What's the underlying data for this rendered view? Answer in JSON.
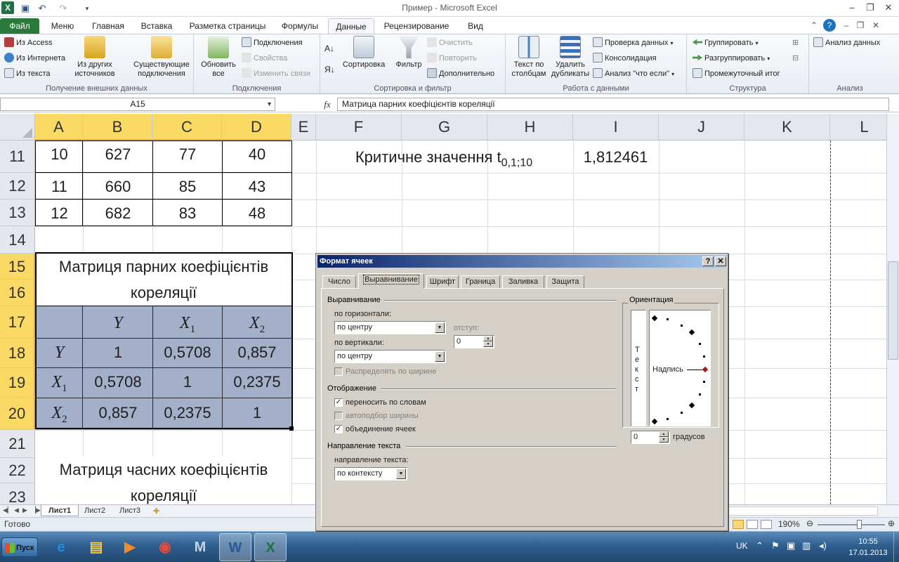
{
  "window": {
    "title": "Пример - Microsoft Excel",
    "app_icon": "X",
    "qat": {
      "save": "save-icon",
      "undo": "undo-icon",
      "redo": "redo-icon",
      "customize": "dropdown-icon"
    },
    "buttons": {
      "minimize": "–",
      "restore": "❐",
      "close": "✕"
    }
  },
  "ribbon_tabs": [
    {
      "label": "Файл"
    },
    {
      "label": "Меню"
    },
    {
      "label": "Главная"
    },
    {
      "label": "Вставка"
    },
    {
      "label": "Разметка страницы"
    },
    {
      "label": "Формулы"
    },
    {
      "label": "Данные"
    },
    {
      "label": "Рецензирование"
    },
    {
      "label": "Вид"
    }
  ],
  "ribbon": {
    "external": {
      "label": "Получение внешних данных",
      "access": "Из Access",
      "web": "Из Интернета",
      "text": "Из текста",
      "other_1": "Из других",
      "other_2": "источников",
      "existing_1": "Существующие",
      "existing_2": "подключения"
    },
    "connections": {
      "label": "Подключения",
      "refresh_1": "Обновить",
      "refresh_2": "все",
      "connections": "Подключения",
      "properties": "Свойства",
      "edit_links": "Изменить связи"
    },
    "sort": {
      "label": "Сортировка и фильтр",
      "sort": "Сортировка",
      "filter": "Фильтр",
      "clear": "Очистить",
      "reapply": "Повторить",
      "advanced": "Дополнительно"
    },
    "datatools": {
      "label": "Работа с данными",
      "t2c_1": "Текст по",
      "t2c_2": "столбцам",
      "dup_1": "Удалить",
      "dup_2": "дубликаты",
      "validation": "Проверка данных",
      "consolidate": "Консолидация",
      "whatif": "Анализ \"что если\""
    },
    "outline": {
      "label": "Структура",
      "group": "Группировать",
      "ungroup": "Разгруппировать",
      "subtotal": "Промежуточный итог"
    },
    "analysis": {
      "label": "Анализ",
      "data_analysis": "Анализ данных"
    }
  },
  "formula_bar": {
    "name_box": "A15",
    "fx": "fx",
    "formula": "Матрица парних коефіцієнтів кореляції"
  },
  "columns": [
    "A",
    "B",
    "C",
    "D",
    "E",
    "F",
    "G",
    "H",
    "I",
    "J",
    "K",
    "L"
  ],
  "rows": [
    "11",
    "12",
    "13",
    "14",
    "15",
    "16",
    "17",
    "18",
    "19",
    "20",
    "21",
    "22",
    "23"
  ],
  "sheet": {
    "data_rows": [
      [
        "10",
        "627",
        "77",
        "40"
      ],
      [
        "11",
        "660",
        "85",
        "43"
      ],
      [
        "12",
        "682",
        "83",
        "48"
      ]
    ],
    "critical_label": "Критичне значення t",
    "critical_sub": "0,1;10",
    "critical_value": "1,812461",
    "title1_line1": "Матриця парних коефіцієнтів",
    "title1_line2": "кореляції",
    "matrix_header": [
      "",
      "Y",
      "X",
      "X"
    ],
    "matrix_header_sub": [
      "",
      "",
      "1",
      "2"
    ],
    "matrix_rows": [
      {
        "label": "Y",
        "sub": "",
        "values": [
          "1",
          "0,5708",
          "0,857"
        ]
      },
      {
        "label": "X",
        "sub": "1",
        "values": [
          "0,5708",
          "1",
          "0,2375"
        ]
      },
      {
        "label": "X",
        "sub": "2",
        "values": [
          "0,857",
          "0,2375",
          "1"
        ]
      }
    ],
    "title2_line1": "Матриця часних коефіцієнтів",
    "title2_line2": "кореляції",
    "matrix_fill": "#a4b0c9"
  },
  "sheet_tabs": [
    "Лист1",
    "Лист2",
    "Лист3"
  ],
  "status": {
    "ready": "Готово",
    "zoom": "190%"
  },
  "dialog": {
    "title": "Формат ячеек",
    "tabs": [
      "Число",
      "Выравнивание",
      "Шрифт",
      "Граница",
      "Заливка",
      "Защита"
    ],
    "alignment_section": "Выравнивание",
    "horizontal_label": "по горизонтали:",
    "horizontal_value": "по центру",
    "indent_label": "отступ:",
    "indent_value": "0",
    "vertical_label": "по вертикали:",
    "vertical_value": "по центру",
    "distributed": "Распределять по ширине",
    "display_section": "Отображение",
    "wrap": "переносить по словам",
    "shrink": "автоподбор ширины",
    "merge": "объединение ячеек",
    "direction_section": "Направление текста",
    "direction_label": "направление текста:",
    "direction_value": "по контексту",
    "orientation_section": "Ориентация",
    "vertical_text": [
      "Т",
      "е",
      "к",
      "с",
      "т"
    ],
    "dial_label": "Надпись",
    "degrees_value": "0",
    "degrees_label": "градусов"
  },
  "taskbar": {
    "start": "Пуск",
    "apps": [
      "ie-icon",
      "explorer-icon",
      "media-player-icon",
      "chrome-icon",
      "m-app-icon",
      "word-icon",
      "excel-icon"
    ],
    "lang": "UK",
    "time": "10:55",
    "date": "17.01.2013"
  }
}
